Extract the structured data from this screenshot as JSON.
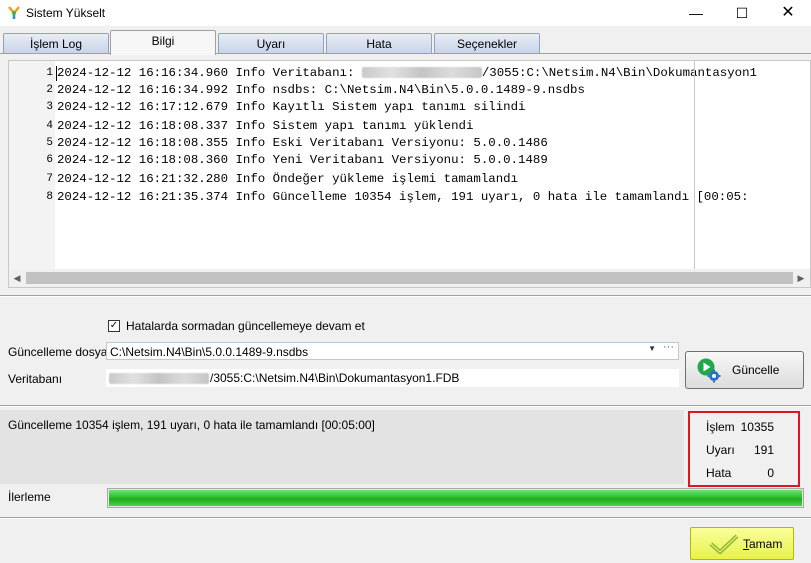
{
  "window": {
    "title": "Sistem Yükselt"
  },
  "tabs": [
    {
      "label": "İşlem Log"
    },
    {
      "label": "Bilgi"
    },
    {
      "label": "Uyarı"
    },
    {
      "label": "Hata"
    },
    {
      "label": "Seçenekler"
    }
  ],
  "log": {
    "lines": [
      {
        "no": "1",
        "pre": "2024-12-12 16:16:34.960 Info Veritabanı: ",
        "post": "/3055:C:\\Netsim.N4\\Bin\\Dokumantasyon1"
      },
      {
        "no": "2",
        "text": "2024-12-12 16:16:34.992 Info nsdbs: C:\\Netsim.N4\\Bin\\5.0.0.1489-9.nsdbs"
      },
      {
        "no": "3",
        "text": "2024-12-12 16:17:12.679 Info Kayıtlı Sistem yapı tanımı silindi"
      },
      {
        "no": "4",
        "text": "2024-12-12 16:18:08.337 Info Sistem yapı tanımı yüklendi"
      },
      {
        "no": "5",
        "text": "2024-12-12 16:18:08.355 Info Eski Veritabanı Versiyonu: 5.0.0.1486"
      },
      {
        "no": "6",
        "text": "2024-12-12 16:18:08.360 Info Yeni Veritabanı Versiyonu: 5.0.0.1489"
      },
      {
        "no": "7",
        "text": "2024-12-12 16:21:32.280 Info Öndeğer yükleme işlemi tamamlandı"
      },
      {
        "no": "8",
        "text": "2024-12-12 16:21:35.374 Info Güncelleme 10354 işlem, 191 uyarı, 0 hata ile tamamlandı [00:05:"
      }
    ]
  },
  "options": {
    "continue_label": "Hatalarda sormadan güncellemeye devam et",
    "continue_checked": "✓",
    "file_label": "Güncelleme dosyası",
    "file_value": "C:\\Netsim.N4\\Bin\\5.0.0.1489-9.nsdbs",
    "file_more": "···",
    "db_label": "Veritabanı",
    "db_value_suffix": "/3055:C:\\Netsim.N4\\Bin\\Dokumantasyon1.FDB",
    "update_button": "Güncelle"
  },
  "status": {
    "message": "Güncelleme 10354 işlem, 191 uyarı, 0 hata ile tamamlandı [00:05:00]",
    "stats": [
      {
        "label": "İşlem",
        "value": "10355"
      },
      {
        "label": "Uyarı",
        "value": "191"
      },
      {
        "label": "Hata",
        "value": "0"
      }
    ],
    "progress_label": "İlerleme",
    "progress_percent": 100
  },
  "footer": {
    "ok_first": "T",
    "ok_rest": "amam"
  },
  "colors": {
    "highlight_border": "#e0141e",
    "ok_button": "#e7f24c",
    "progress": "#2fbf2f"
  }
}
